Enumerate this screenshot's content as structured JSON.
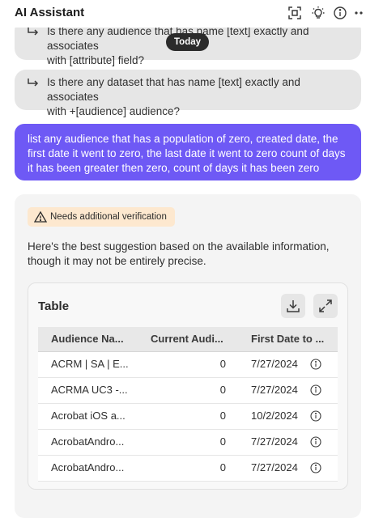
{
  "header": {
    "title": "AI Assistant",
    "icons": [
      "focus-frame-icon",
      "lightbulb-icon",
      "info-icon",
      "more-icon"
    ]
  },
  "today_label": "Today",
  "suggestions": [
    {
      "line1": "Is there any audience that has name [text] exactly and associates",
      "line2": "with [attribute] field?"
    },
    {
      "line1": "Is there any dataset that has name [text] exactly and associates",
      "line2": "with +[audience] audience?"
    }
  ],
  "user_message": "list any audience that has a population of zero, created date, the first date it went to zero, the last date it went to zero count of days it has been greater then zero, count of days it has been zero",
  "answer": {
    "badge": "Needs additional verification",
    "text": "Here's the best suggestion based on the available information, though it may not be entirely precise.",
    "table": {
      "title": "Table",
      "columns": [
        "Audience Na...",
        "Current Audi...",
        "First Date to ..."
      ],
      "rows": [
        {
          "name": "ACRM | SA | E...",
          "current": "0",
          "first_date": "7/27/2024"
        },
        {
          "name": "ACRMA UC3 -...",
          "current": "0",
          "first_date": "7/27/2024"
        },
        {
          "name": "Acrobat iOS a...",
          "current": "0",
          "first_date": "10/2/2024"
        },
        {
          "name": "AcrobatAndro...",
          "current": "0",
          "first_date": "7/27/2024"
        },
        {
          "name": "AcrobatAndro...",
          "current": "0",
          "first_date": "7/27/2024"
        }
      ]
    }
  },
  "colors": {
    "user_bubble": "#6e59f5",
    "suggestion_bg": "#e6e6e6",
    "badge_bg": "#fde8cf"
  }
}
